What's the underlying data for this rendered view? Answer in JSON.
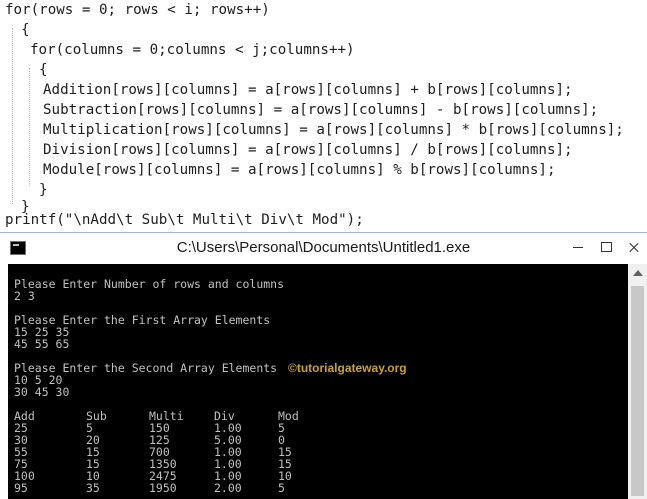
{
  "code": {
    "lines": [
      "for(rows = 0; rows < i; rows++)",
      "{",
      "for(columns = 0;columns < j;columns++)",
      "{",
      "Addition[rows][columns] = a[rows][columns] + b[rows][columns];",
      "Subtraction[rows][columns] = a[rows][columns] - b[rows][columns];",
      "Multiplication[rows][columns] = a[rows][columns] * b[rows][columns];",
      "Division[rows][columns] = a[rows][columns] / b[rows][columns];",
      "Module[rows][columns] = a[rows][columns] % b[rows][columns];",
      "}",
      "}",
      "printf(\"\\nAdd\\t Sub\\t Multi\\t Div\\t Mod\");"
    ]
  },
  "console": {
    "title": "C:\\Users\\Personal\\Documents\\Untitled1.exe",
    "icons": {
      "app": "console-app-icon",
      "minimize": "minimize-icon",
      "maximize": "maximize-icon",
      "close": "close-icon"
    },
    "prompt_rows_cols": "Please Enter Number of rows and columns",
    "input_rows_cols": "2 3",
    "prompt_first": "Please Enter the First Array Elements",
    "first_row_1": "15 25 35",
    "first_row_2": "45 55 65",
    "prompt_second": "Please Enter the Second Array Elements",
    "second_row_1": "10 5 20",
    "second_row_2": "30 45 30",
    "table": {
      "headers": [
        "Add",
        "Sub",
        "Multi",
        "Div",
        "Mod"
      ],
      "rows": [
        [
          "25",
          "5",
          "150",
          "1.00",
          "5"
        ],
        [
          "30",
          "20",
          "125",
          "5.00",
          "0"
        ],
        [
          "55",
          "15",
          "700",
          "1.00",
          "15"
        ],
        [
          "75",
          "15",
          "1350",
          "1.00",
          "15"
        ],
        [
          "100",
          "10",
          "2475",
          "1.00",
          "10"
        ],
        [
          "95",
          "35",
          "1950",
          "2.00",
          "5"
        ]
      ]
    },
    "watermark": "©tutorialgateway.org"
  },
  "colors": {
    "keyword": "#000080",
    "operator": "#800080",
    "number": "#c08040",
    "string": "#a31515",
    "console_bg": "#000000",
    "console_text": "#c0c0c0",
    "watermark": "#c9a227"
  }
}
